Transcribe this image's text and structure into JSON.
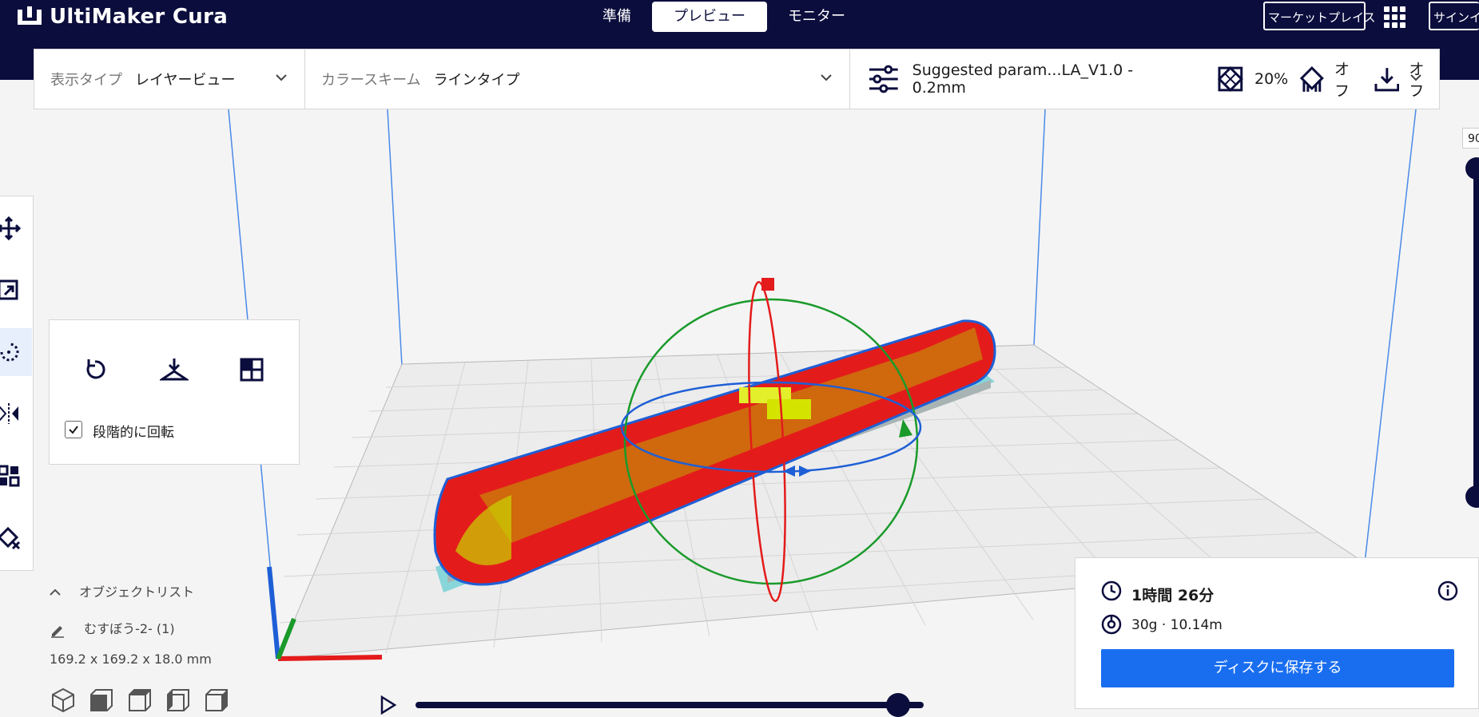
{
  "app": {
    "title": "UltiMaker Cura"
  },
  "stages": [
    {
      "label": "準備",
      "active": false
    },
    {
      "label": "プレビュー",
      "active": true
    },
    {
      "label": "モニター",
      "active": false
    }
  ],
  "header_buttons": {
    "marketplace": "マーケットプレイス",
    "signin": "サインイン"
  },
  "view_type": {
    "label": "表示タイプ",
    "value": "レイヤービュー"
  },
  "color_scheme": {
    "label": "カラースキーム",
    "value": "ラインタイプ"
  },
  "print_settings": {
    "profile": "Suggested param...LA_V1.0 - 0.2mm",
    "infill": "20%",
    "support": "オフ",
    "adhesion": "オフ"
  },
  "rotate_panel": {
    "snap_rotation_label": "段階的に回転",
    "snap_rotation_checked": true
  },
  "object_list": {
    "header": "オブジェクトリスト",
    "object_name": "むすぼう-2- (1)",
    "dimensions": "169.2 x 169.2 x 18.0 mm"
  },
  "print_info": {
    "time": "1時間 26分",
    "material": "30g · 10.14m",
    "save_button": "ディスクに保存する"
  },
  "layer_slider": {
    "current_layer": "90"
  },
  "simulation": {
    "progress": 0.95
  },
  "colors": {
    "header_bg": "#0b0d3d",
    "accent_blue": "#196ef0",
    "model_red": "#e41b1b",
    "infill_yellow": "#d9e600",
    "rotate_green": "#1a9a2a",
    "rotate_blue": "#1e5fd6"
  }
}
